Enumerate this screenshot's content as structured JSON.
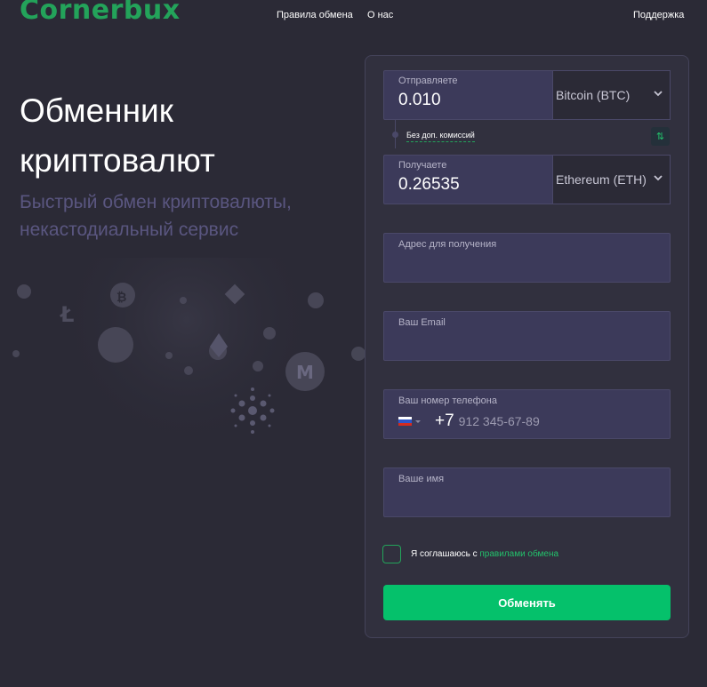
{
  "header": {
    "logo": "Cornerbux",
    "nav": {
      "rules": "Правила обмена",
      "about": "О нас",
      "support": "Поддержка"
    }
  },
  "hero": {
    "title": "Обменник криптовалют",
    "subtitle": "Быстрый обмен криптовалюты, некастодиальный сервис"
  },
  "exchange": {
    "send": {
      "label": "Отправляете",
      "value": "0.010",
      "currency": "Bitcoin (BTC)"
    },
    "no_fee_label": "Без доп. комиссий",
    "swap_icon": "⇅",
    "receive": {
      "label": "Получаете",
      "value": "0.26535",
      "currency": "Ethereum (ETH)"
    }
  },
  "fields": {
    "address": {
      "label": "Адрес для получения"
    },
    "email": {
      "label": "Ваш Email"
    },
    "phone": {
      "label": "Ваш номер телефона",
      "code": "+7",
      "placeholder": "912 345-67-89"
    },
    "name": {
      "label": "Ваше имя"
    }
  },
  "agreement": {
    "prefix": "Я соглашаюсь с ",
    "link": "правилами обмена"
  },
  "submit_label": "Обменять",
  "colors": {
    "brand": "#23a35a",
    "button": "#05c16b",
    "background": "#2b2a36",
    "panel": "#31303e",
    "field": "#3c3a5a"
  }
}
